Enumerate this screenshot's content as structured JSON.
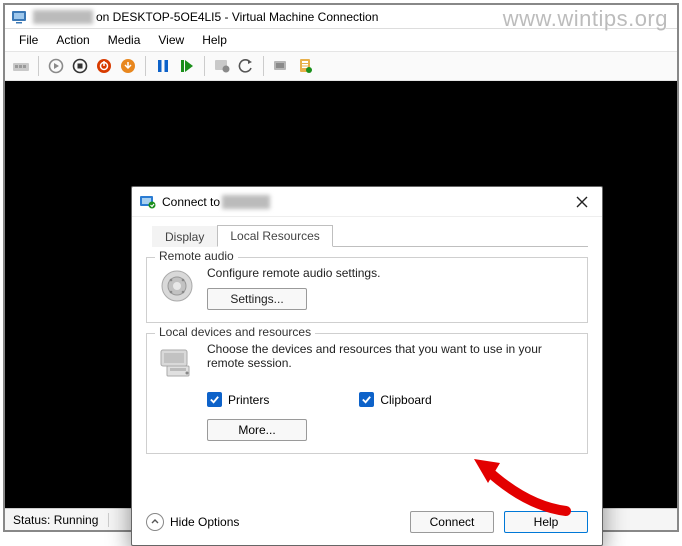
{
  "watermark": "www.wintips.org",
  "window": {
    "title_suffix": "on DESKTOP-5OE4LI5 - Virtual Machine Connection"
  },
  "menubar": [
    "File",
    "Action",
    "Media",
    "View",
    "Help"
  ],
  "statusbar": {
    "text": "Status: Running"
  },
  "dialog": {
    "title_prefix": "Connect to ",
    "tabs": {
      "display": "Display",
      "local": "Local Resources"
    },
    "remote_audio": {
      "group_title": "Remote audio",
      "desc": "Configure remote audio settings.",
      "settings_btn": "Settings..."
    },
    "local_devices": {
      "group_title": "Local devices and resources",
      "desc": "Choose the devices and resources that you want to use in your remote session.",
      "printers": "Printers",
      "clipboard": "Clipboard",
      "more_btn": "More..."
    },
    "hide_options": "Hide Options",
    "connect": "Connect",
    "help": "Help"
  }
}
